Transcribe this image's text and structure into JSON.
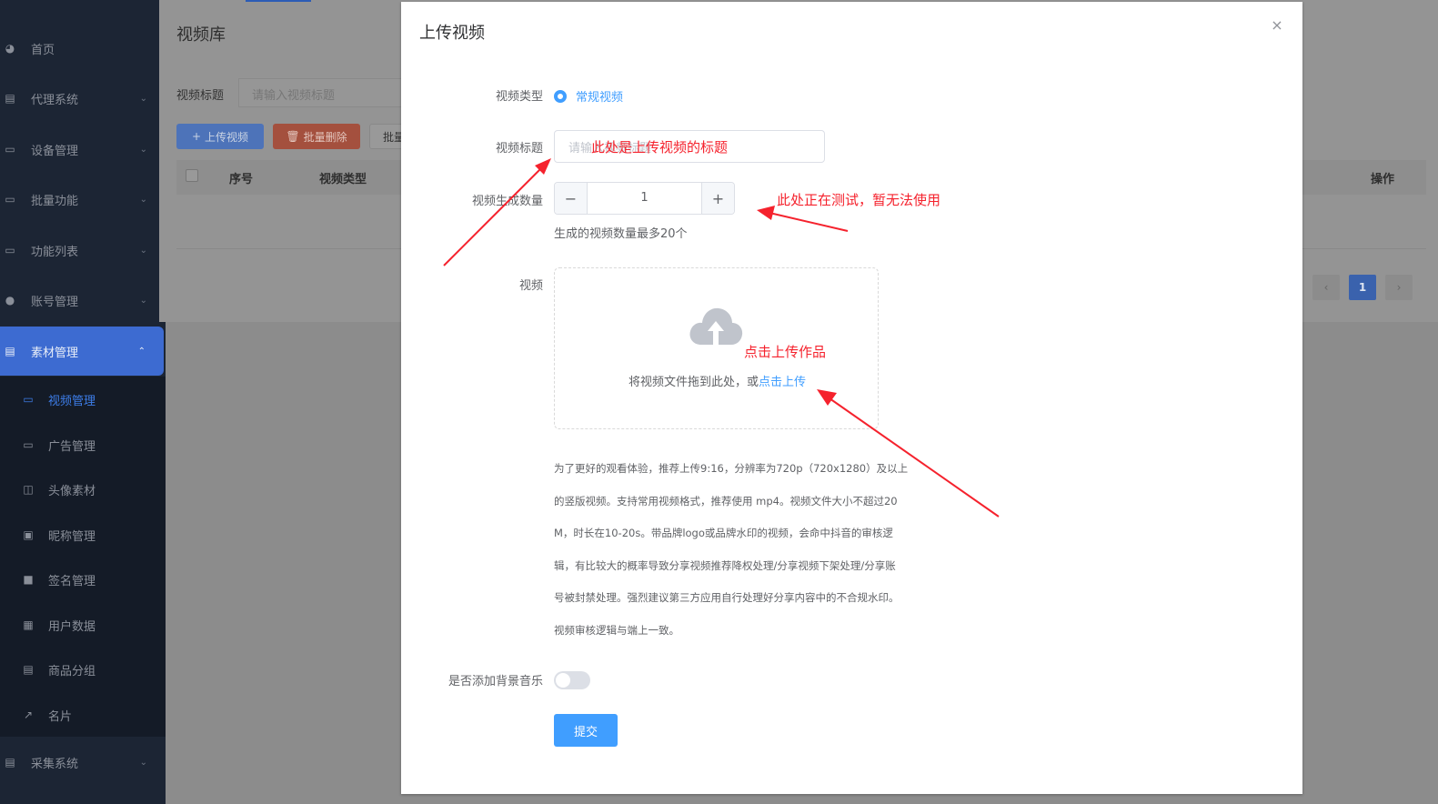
{
  "sidebar": {
    "items": [
      {
        "label": "首页",
        "icon": "dashboard-icon",
        "has_arrow": false
      },
      {
        "label": "代理系统",
        "icon": "document-icon",
        "has_arrow": true
      },
      {
        "label": "设备管理",
        "icon": "monitor-icon",
        "has_arrow": true
      },
      {
        "label": "批量功能",
        "icon": "chart-monitor-icon",
        "has_arrow": true
      },
      {
        "label": "功能列表",
        "icon": "chart-monitor-icon",
        "has_arrow": true
      },
      {
        "label": "账号管理",
        "icon": "users-icon",
        "has_arrow": true
      },
      {
        "label": "素材管理",
        "icon": "document-icon",
        "has_arrow": true,
        "expanded": true
      },
      {
        "label": "采集系统",
        "icon": "document-icon",
        "has_arrow": true
      }
    ],
    "sub_items": [
      {
        "label": "视频管理",
        "icon": "monitor-icon",
        "active": true
      },
      {
        "label": "广告管理",
        "icon": "monitor-icon"
      },
      {
        "label": "头像素材",
        "icon": "book-icon"
      },
      {
        "label": "昵称管理",
        "icon": "id-card-icon"
      },
      {
        "label": "签名管理",
        "icon": "text-box-icon"
      },
      {
        "label": "用户数据",
        "icon": "table-icon"
      },
      {
        "label": "商品分组",
        "icon": "list-doc-icon"
      },
      {
        "label": "名片",
        "icon": "external-link-icon"
      }
    ],
    "accent_color": "#3d6bd1"
  },
  "background_page": {
    "title": "视频库",
    "filter_label": "视频标题",
    "filter_placeholder": "请输入视频标题",
    "buttons": {
      "upload": "上传视频",
      "batch_delete": "批量删除",
      "batch_partial": "批量"
    },
    "table_headers": {
      "index": "序号",
      "type": "视频类型",
      "actions": "操作"
    },
    "pagination": {
      "current": "1",
      "prev": "‹",
      "next": "›"
    }
  },
  "dialog": {
    "title": "上传视频",
    "close_symbol": "×",
    "fields": {
      "type_label": "视频类型",
      "type_option": "常规视频",
      "title_label": "视频标题",
      "title_placeholder": "请输入视频标题",
      "count_label": "视频生成数量",
      "count_value": "1",
      "count_minus": "−",
      "count_plus": "+",
      "count_hint": "生成的视频数量最多20个",
      "video_label": "视频",
      "upload_text": "将视频文件拖到此处，或",
      "upload_link": "点击上传",
      "tip_lines": [
        "为了更好的观看体验，推荐上传9:16，分辨率为720p（720x1280）及以上",
        "的竖版视频。支持常用视频格式，推荐使用 mp4。视频文件大小不超过20",
        "M，时长在10-20s。带品牌logo或品牌水印的视频，会命中抖音的审核逻",
        "辑，有比较大的概率导致分享视频推荐降权处理/分享视频下架处理/分享账",
        "号被封禁处理。强烈建议第三方应用自行处理好分享内容中的不合规水印。",
        "视频审核逻辑与端上一致。"
      ],
      "music_label": "是否添加背景音乐",
      "music_enabled": false,
      "submit": "提交"
    },
    "primary_color": "#409eff"
  },
  "annotations": {
    "title_note": "此处是上传视频的标题",
    "count_note": "此处正在测试，暂无法使用",
    "upload_note": "点击上传作品",
    "color": "#f5222d"
  }
}
